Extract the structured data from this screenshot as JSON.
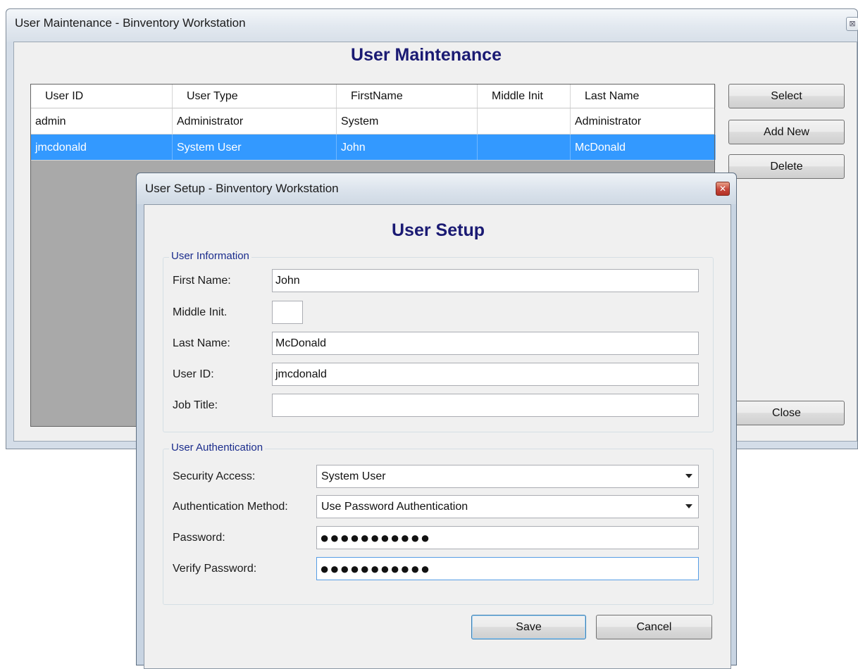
{
  "main_window": {
    "title": "User Maintenance - Binventory Workstation",
    "close_glyph": "⊠",
    "heading": "User Maintenance",
    "grid": {
      "columns": [
        "User ID",
        "User Type",
        "FirstName",
        "Middle Init",
        "Last Name"
      ],
      "rows": [
        {
          "user_id": "admin",
          "user_type": "Administrator",
          "first_name": "System",
          "middle_init": "",
          "last_name": "Administrator",
          "selected": false
        },
        {
          "user_id": "jmcdonald",
          "user_type": "System User",
          "first_name": "John",
          "middle_init": "",
          "last_name": "McDonald",
          "selected": true
        }
      ]
    },
    "buttons": {
      "select": "Select",
      "add_new": "Add New",
      "delete": "Delete",
      "close": "Close"
    }
  },
  "dialog": {
    "title": "User Setup - Binventory Workstation",
    "close_glyph": "✕",
    "heading": "User Setup",
    "user_information": {
      "group_label": "User Information",
      "first_name_label": "First Name:",
      "first_name_value": "John",
      "middle_init_label": "Middle Init.",
      "middle_init_value": "",
      "last_name_label": "Last Name:",
      "last_name_value": "McDonald",
      "user_id_label": "User ID:",
      "user_id_value": "jmcdonald",
      "job_title_label": "Job Title:",
      "job_title_value": ""
    },
    "user_authentication": {
      "group_label": "User Authentication",
      "security_access_label": "Security Access:",
      "security_access_value": "System User",
      "auth_method_label": "Authentication Method:",
      "auth_method_value": "Use Password Authentication",
      "password_label": "Password:",
      "password_value": "●●●●●●●●●●●",
      "verify_password_label": "Verify Password:",
      "verify_password_value": "●●●●●●●●●●●"
    },
    "buttons": {
      "save": "Save",
      "cancel": "Cancel"
    }
  },
  "colors": {
    "heading": "#1a1a73",
    "selection": "#3399ff",
    "group_title": "#1a2c8c"
  }
}
